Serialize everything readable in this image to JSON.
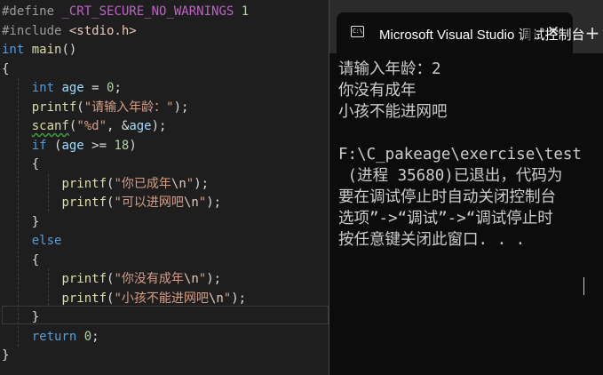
{
  "editor": {
    "lines": [
      [
        [
          "pp",
          "#define "
        ],
        [
          "mac",
          "_CRT_SECURE_NO_WARNINGS"
        ],
        [
          "pun",
          " "
        ],
        [
          "num",
          "1"
        ]
      ],
      [
        [
          "pp",
          "#include "
        ],
        [
          "hdr",
          "<stdio.h>"
        ]
      ],
      [
        [
          "kw",
          "int"
        ],
        [
          "pun",
          " "
        ],
        [
          "fn",
          "main"
        ],
        [
          "pun",
          "()"
        ]
      ],
      [
        [
          "pun",
          "{"
        ]
      ],
      [
        [
          "pun",
          "    "
        ],
        [
          "kw",
          "int"
        ],
        [
          "pun",
          " "
        ],
        [
          "var",
          "age"
        ],
        [
          "pun",
          " = "
        ],
        [
          "num",
          "0"
        ],
        [
          "pun",
          ";"
        ]
      ],
      [
        [
          "pun",
          "    "
        ],
        [
          "fn",
          "printf"
        ],
        [
          "pun",
          "("
        ],
        [
          "str",
          "\"请输入年龄：\""
        ],
        [
          "pun",
          ");"
        ]
      ],
      [
        [
          "pun",
          "    "
        ],
        [
          "fn squig",
          "scanf"
        ],
        [
          "pun",
          "("
        ],
        [
          "str",
          "\"%d\""
        ],
        [
          "pun",
          ", &"
        ],
        [
          "var",
          "age"
        ],
        [
          "pun",
          ");"
        ]
      ],
      [
        [
          "pun",
          "    "
        ],
        [
          "kw",
          "if"
        ],
        [
          "pun",
          " ("
        ],
        [
          "var",
          "age"
        ],
        [
          "pun",
          " >= "
        ],
        [
          "num",
          "18"
        ],
        [
          "pun",
          ")"
        ]
      ],
      [
        [
          "pun",
          "    {"
        ]
      ],
      [
        [
          "pun",
          "        "
        ],
        [
          "fn",
          "printf"
        ],
        [
          "pun",
          "("
        ],
        [
          "str",
          "\"你已成年"
        ],
        [
          "esc",
          "\\n"
        ],
        [
          "str",
          "\""
        ],
        [
          "pun",
          ");"
        ]
      ],
      [
        [
          "pun",
          "        "
        ],
        [
          "fn",
          "printf"
        ],
        [
          "pun",
          "("
        ],
        [
          "str",
          "\"可以进网吧"
        ],
        [
          "esc",
          "\\n"
        ],
        [
          "str",
          "\""
        ],
        [
          "pun",
          ");"
        ]
      ],
      [
        [
          "pun",
          "    }"
        ]
      ],
      [
        [
          "pun",
          "    "
        ],
        [
          "kw",
          "else"
        ]
      ],
      [
        [
          "pun",
          "    {"
        ]
      ],
      [
        [
          "pun",
          "        "
        ],
        [
          "fn",
          "printf"
        ],
        [
          "pun",
          "("
        ],
        [
          "str",
          "\"你没有成年"
        ],
        [
          "esc",
          "\\n"
        ],
        [
          "str",
          "\""
        ],
        [
          "pun",
          ");"
        ]
      ],
      [
        [
          "pun",
          "        "
        ],
        [
          "fn",
          "printf"
        ],
        [
          "pun",
          "("
        ],
        [
          "str",
          "\"小孩不能进网吧"
        ],
        [
          "esc",
          "\\n"
        ],
        [
          "str",
          "\""
        ],
        [
          "pun",
          ");"
        ]
      ],
      [
        [
          "pun",
          "    }"
        ]
      ],
      [
        [
          "pun",
          "    "
        ],
        [
          "kw",
          "return"
        ],
        [
          "pun",
          " "
        ],
        [
          "num",
          "0"
        ],
        [
          "pun",
          ";"
        ]
      ],
      [
        [
          "pun",
          "}"
        ]
      ]
    ]
  },
  "console": {
    "tab_icon_text": "C:\\",
    "tab_title": "Microsoft Visual Studio 调试控制台",
    "close_glyph": "✕",
    "new_tab_glyph": "+",
    "output_lines": [
      "请输入年龄：2",
      "你没有成年",
      "小孩不能进网吧",
      "",
      "F:\\C_pakeage\\exercise\\test",
      " (进程 35680)已退出，代码为",
      "要在调试停止时自动关闭控制台",
      "选项”->“调试”->“调试停止时",
      "按任意键关闭此窗口. . ."
    ]
  },
  "colors": {
    "editor_bg": "#1e1e1e",
    "console_bg": "#0c0c0c",
    "titlebar_bg": "#2b2b2b",
    "keyword": "#569cd6",
    "function": "#dcdcaa",
    "string": "#d69d85",
    "variable": "#9cdcfe",
    "number": "#b5cea8"
  }
}
